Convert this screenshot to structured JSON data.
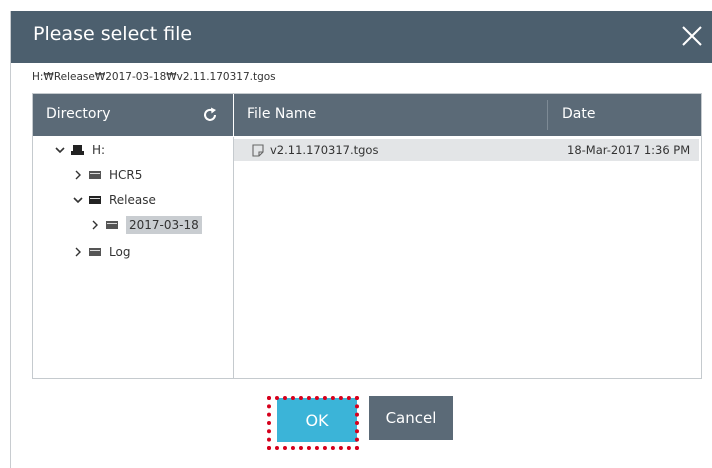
{
  "dialog": {
    "title": "Please select file",
    "path": "H:₩Release₩2017-03-18₩v2.11.170317.tgos"
  },
  "directory": {
    "header": "Directory",
    "tree": [
      {
        "label": "H:",
        "level": 0,
        "expanded": true,
        "icon": "drive-icon"
      },
      {
        "label": "HCR5",
        "level": 1,
        "expanded": false,
        "icon": "folder-icon"
      },
      {
        "label": "Release",
        "level": 1,
        "expanded": true,
        "icon": "folder-icon"
      },
      {
        "label": "2017-03-18",
        "level": 2,
        "expanded": false,
        "icon": "folder-icon",
        "selected": true
      },
      {
        "label": "Log",
        "level": 1,
        "expanded": false,
        "icon": "folder-icon"
      }
    ]
  },
  "file_list": {
    "columns": {
      "name": "File Name",
      "date": "Date"
    },
    "files": [
      {
        "name": "v2.11.170317.tgos",
        "date": "18-Mar-2017 1:36 PM"
      }
    ]
  },
  "buttons": {
    "ok": "OK",
    "cancel": "Cancel"
  },
  "colors": {
    "titlebar": "#4c5f6e",
    "header": "#5b6a77",
    "ok_button": "#3bb4d8",
    "highlight_outline": "#d6001c"
  }
}
